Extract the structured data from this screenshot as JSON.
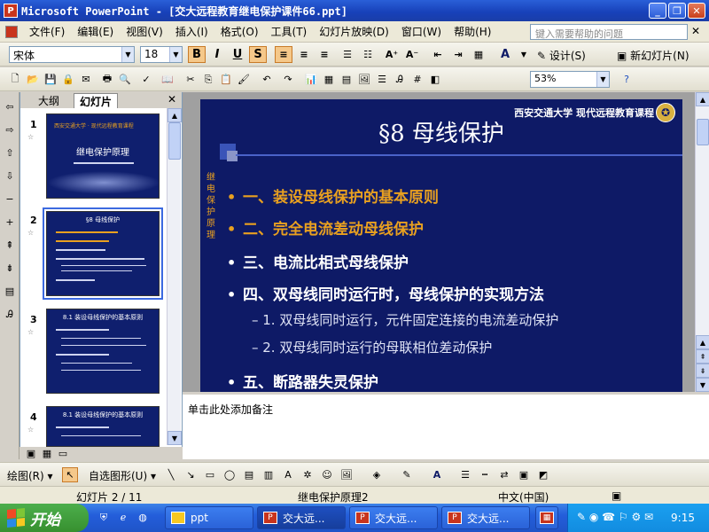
{
  "window": {
    "title": "Microsoft PowerPoint - [交大远程教育继电保护课件66.ppt]",
    "min_icon": "minimize-icon",
    "max_icon": "restore-icon",
    "close_icon": "close-icon"
  },
  "menu": {
    "items": [
      "文件(F)",
      "编辑(E)",
      "视图(V)",
      "插入(I)",
      "格式(O)",
      "工具(T)",
      "幻灯片放映(D)",
      "窗口(W)",
      "帮助(H)"
    ],
    "help_placeholder": "键入需要帮助的问题"
  },
  "format_toolbar": {
    "font": "宋体",
    "size": "18",
    "bold": "B",
    "italic": "I",
    "underline": "U",
    "shadow": "S",
    "design_label": "设计(S)",
    "new_slide_label": "新幻灯片(N)"
  },
  "standard_toolbar": {
    "zoom": "53%"
  },
  "left_pane": {
    "tab_outline": "大纲",
    "tab_slides": "幻灯片",
    "slides": [
      {
        "num": "1",
        "title": "继电保护原理"
      },
      {
        "num": "2",
        "title": "§8 母线保护"
      },
      {
        "num": "3",
        "title": "8.1 装设母线保护的基本原则"
      },
      {
        "num": "4",
        "title": "8.1 装设母线保护的基本原则"
      }
    ]
  },
  "slide": {
    "header": "西安交通大学  现代远程教育课程",
    "title": "§8   母线保护",
    "side_label": "继电保护原理",
    "bullets": [
      {
        "text": "一、装设母线保护的基本原则",
        "color": "#e8a020"
      },
      {
        "text": "二、完全电流差动母线保护",
        "color": "#e8a020"
      },
      {
        "text": "三、电流比相式母线保护",
        "color": "#ffffff"
      },
      {
        "text": "四、双母线同时运行时，母线保护的实现方法",
        "color": "#ffffff"
      },
      {
        "text": "五、断路器失灵保护",
        "color": "#ffffff"
      }
    ],
    "sub_bullets": [
      "– 1. 双母线同时运行，元件固定连接的电流差动保护",
      "– 2. 双母线同时运行的母联相位差动保护"
    ]
  },
  "notes": {
    "placeholder": "单击此处添加备注"
  },
  "drawing_toolbar": {
    "draw_label": "绘图(R)",
    "autoshapes_label": "自选图形(U)"
  },
  "status": {
    "slide_pos": "幻灯片 2 / 11",
    "design": "继电保护原理2",
    "language": "中文(中国)"
  },
  "taskbar": {
    "start": "开始",
    "tasks": [
      "ppt",
      "交大远...",
      "交大远...",
      "交大远..."
    ],
    "clock": "9:15"
  },
  "colors": {
    "slide_bg": "#0e1a66",
    "accent_orange": "#e8a020",
    "titlebar": "#1740b8",
    "start_green": "#37902f"
  }
}
